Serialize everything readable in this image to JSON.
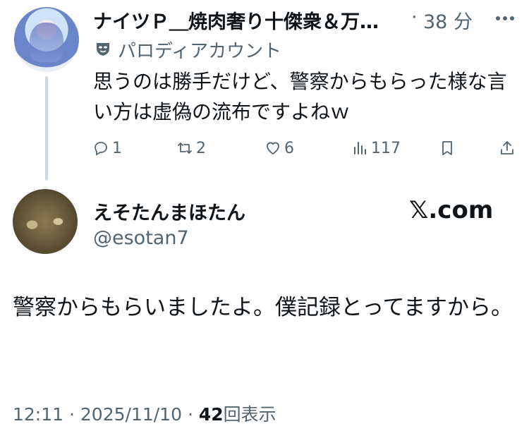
{
  "parent_tweet": {
    "display_name": "ナイツＰ＿焼肉奢り十傑衆＆万…",
    "separator": "·",
    "time_ago": "38 分",
    "account_label": "パロディアカウント",
    "text": "思うのは勝手だけど、警察からもらった様な言い方は虚偽の流布ですよねｗ",
    "actions": {
      "replies": "1",
      "retweets": "2",
      "likes": "6",
      "views": "117"
    }
  },
  "main_tweet": {
    "display_name": "えそたんまほたん",
    "handle": "@esotan7",
    "watermark": "𝕏.com",
    "text": "警察からもらいましたよ。僕記録とってますから。",
    "time": "12:11",
    "separator1": "·",
    "date": "2025/11/10",
    "separator2": "·",
    "view_count": "42",
    "view_label": "回表示"
  },
  "colors": {
    "text_primary": "#0f1419",
    "text_secondary": "#536471",
    "thread_line": "#cfd9de"
  }
}
